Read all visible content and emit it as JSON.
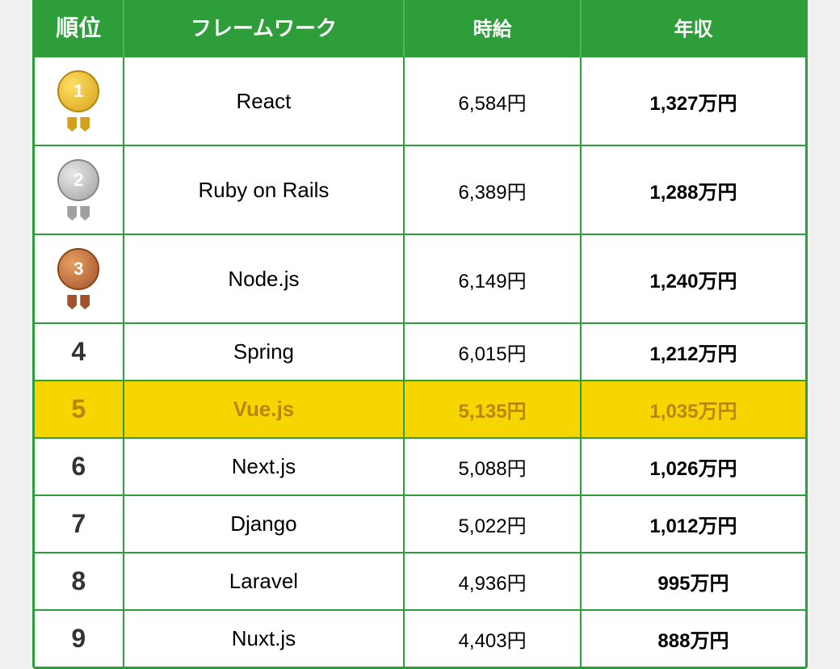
{
  "table": {
    "headers": {
      "rank": "順位",
      "framework": "フレームワーク",
      "hourly": "時給",
      "annual": "年収"
    },
    "rows": [
      {
        "rank": "1",
        "rank_type": "gold",
        "framework": "React",
        "hourly": "6,584円",
        "annual": "1,327万円",
        "highlight": false
      },
      {
        "rank": "2",
        "rank_type": "silver",
        "framework": "Ruby on Rails",
        "hourly": "6,389円",
        "annual": "1,288万円",
        "highlight": false
      },
      {
        "rank": "3",
        "rank_type": "bronze",
        "framework": "Node.js",
        "hourly": "6,149円",
        "annual": "1,240万円",
        "highlight": false
      },
      {
        "rank": "4",
        "rank_type": "plain",
        "framework": "Spring",
        "hourly": "6,015円",
        "annual": "1,212万円",
        "highlight": false
      },
      {
        "rank": "5",
        "rank_type": "plain",
        "framework": "Vue.js",
        "hourly": "5,135円",
        "annual": "1,035万円",
        "highlight": true
      },
      {
        "rank": "6",
        "rank_type": "plain",
        "framework": "Next.js",
        "hourly": "5,088円",
        "annual": "1,026万円",
        "highlight": false
      },
      {
        "rank": "7",
        "rank_type": "plain",
        "framework": "Django",
        "hourly": "5,022円",
        "annual": "1,012万円",
        "highlight": false
      },
      {
        "rank": "8",
        "rank_type": "plain",
        "framework": "Laravel",
        "hourly": "4,936円",
        "annual": "995万円",
        "highlight": false
      },
      {
        "rank": "9",
        "rank_type": "plain",
        "framework": "Nuxt.js",
        "hourly": "4,403円",
        "annual": "888万円",
        "highlight": false
      }
    ]
  }
}
